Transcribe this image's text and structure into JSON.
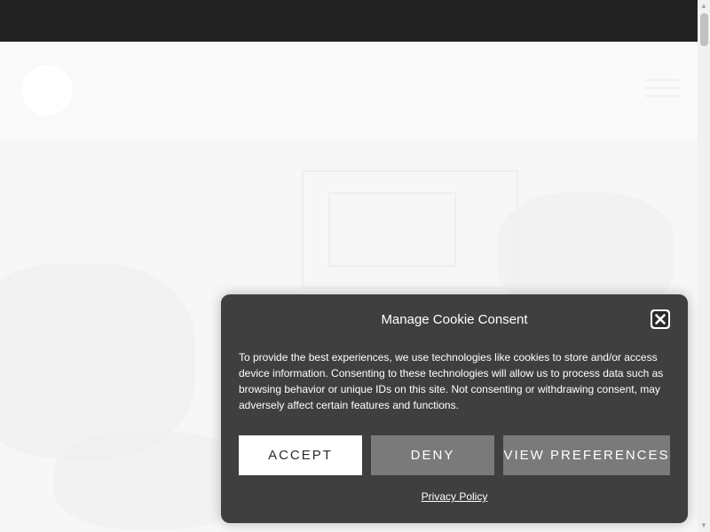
{
  "cookie_dialog": {
    "title": "Manage Cookie Consent",
    "body": "To provide the best experiences, we use technologies like cookies to store and/or access device information. Consenting to these technologies will allow us to process data such as browsing behavior or unique IDs on this site. Not consenting or withdrawing consent, may adversely affect certain features and functions.",
    "buttons": {
      "accept": "ACCEPT",
      "deny": "DENY",
      "preferences": "VIEW PREFERENCES"
    },
    "privacy_link": "Privacy Policy",
    "close_icon": "close-icon"
  },
  "header": {
    "menu_icon": "hamburger-menu-icon"
  },
  "colors": {
    "topbar": "#232323",
    "dialog_bg": "#3f3f3f",
    "accept_bg": "#ffffff",
    "secondary_btn_bg": "#7a7a7a"
  }
}
